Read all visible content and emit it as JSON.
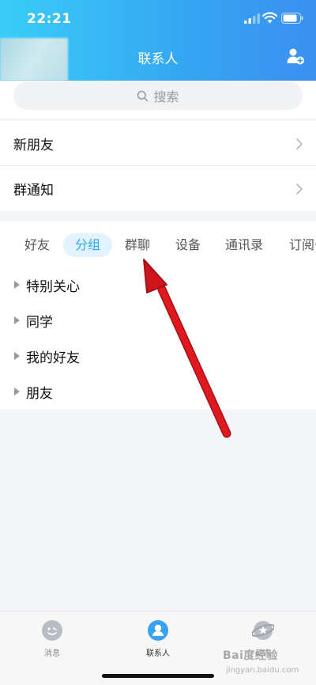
{
  "status_bar": {
    "time": "22:21"
  },
  "header": {
    "title": "联系人"
  },
  "search": {
    "placeholder": "搜索"
  },
  "rows": [
    {
      "label": "新朋友"
    },
    {
      "label": "群通知"
    }
  ],
  "tabs": [
    {
      "label": "好友",
      "active": false
    },
    {
      "label": "分组",
      "active": true
    },
    {
      "label": "群聊",
      "active": false
    },
    {
      "label": "设备",
      "active": false
    },
    {
      "label": "通讯录",
      "active": false
    },
    {
      "label": "订阅号",
      "active": false
    }
  ],
  "groups": [
    {
      "label": "特别关心"
    },
    {
      "label": "同学"
    },
    {
      "label": "我的好友"
    },
    {
      "label": "朋友"
    }
  ],
  "tabbar": [
    {
      "label": "消息",
      "icon": "message-icon",
      "active": false
    },
    {
      "label": "联系人",
      "icon": "contacts-icon",
      "active": true
    },
    {
      "label": "动态",
      "icon": "planet-icon",
      "active": false
    }
  ],
  "watermark": {
    "text": "Bai度经验",
    "sub": "jingyan.baidu.com"
  },
  "colors": {
    "accent": "#2aa8f2",
    "header_start": "#39cdf7",
    "header_end": "#3b8ff0",
    "arrow": "#e0191f"
  }
}
